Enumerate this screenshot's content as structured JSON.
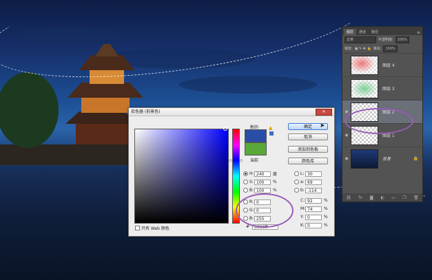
{
  "layers_panel": {
    "tabs": [
      "图层",
      "通道",
      "路径"
    ],
    "kind_label": "正常",
    "opacity_label": "不透明度:",
    "opacity_value": "100%",
    "lock_label": "锁定:",
    "fill_label": "填充:",
    "fill_value": "100%",
    "layers": [
      {
        "name": "图层 4",
        "thumb_color": "#f4a0a0"
      },
      {
        "name": "图层 3",
        "thumb_color": "#98d8a8"
      },
      {
        "name": "图层 2",
        "thumb_color": ""
      },
      {
        "name": "图层 1",
        "thumb_color": ""
      },
      {
        "name": "背景",
        "thumb_color": "#1e3a78"
      }
    ],
    "footer_icons": [
      "link-icon",
      "fx-icon",
      "mask-icon",
      "adjustment-icon",
      "folder-icon",
      "new-layer-icon",
      "trash-icon"
    ]
  },
  "color_picker": {
    "title": "拾色器 (前景色)",
    "new_label": "新的",
    "current_label": "当前",
    "new_color": "#2a4ea8",
    "current_color": "#5aa83a",
    "buttons": {
      "ok": "确定",
      "cancel": "取消",
      "add_swatch": "添加到色板",
      "color_libraries": "颜色库"
    },
    "hsb": [
      {
        "label": "H:",
        "value": "240",
        "unit": "度",
        "selected": true
      },
      {
        "label": "S:",
        "value": "100",
        "unit": "%",
        "selected": false
      },
      {
        "label": "B:",
        "value": "100",
        "unit": "%",
        "selected": false
      }
    ],
    "rgb": [
      {
        "label": "R:",
        "value": "0"
      },
      {
        "label": "G:",
        "value": "0"
      },
      {
        "label": "B:",
        "value": "255"
      }
    ],
    "lab": [
      {
        "label": "L:",
        "value": "30"
      },
      {
        "label": "a:",
        "value": "69"
      },
      {
        "label": "b:",
        "value": "-114"
      }
    ],
    "cmyk": [
      {
        "label": "C:",
        "value": "92",
        "unit": "%"
      },
      {
        "label": "M:",
        "value": "74",
        "unit": "%"
      },
      {
        "label": "Y:",
        "value": "0",
        "unit": "%"
      },
      {
        "label": "K:",
        "value": "0",
        "unit": "%"
      }
    ],
    "hex_label": "#",
    "hex_value": "0000ff",
    "web_only_label": "只有 Web 颜色"
  },
  "highlight_color": "#9a5bb7"
}
